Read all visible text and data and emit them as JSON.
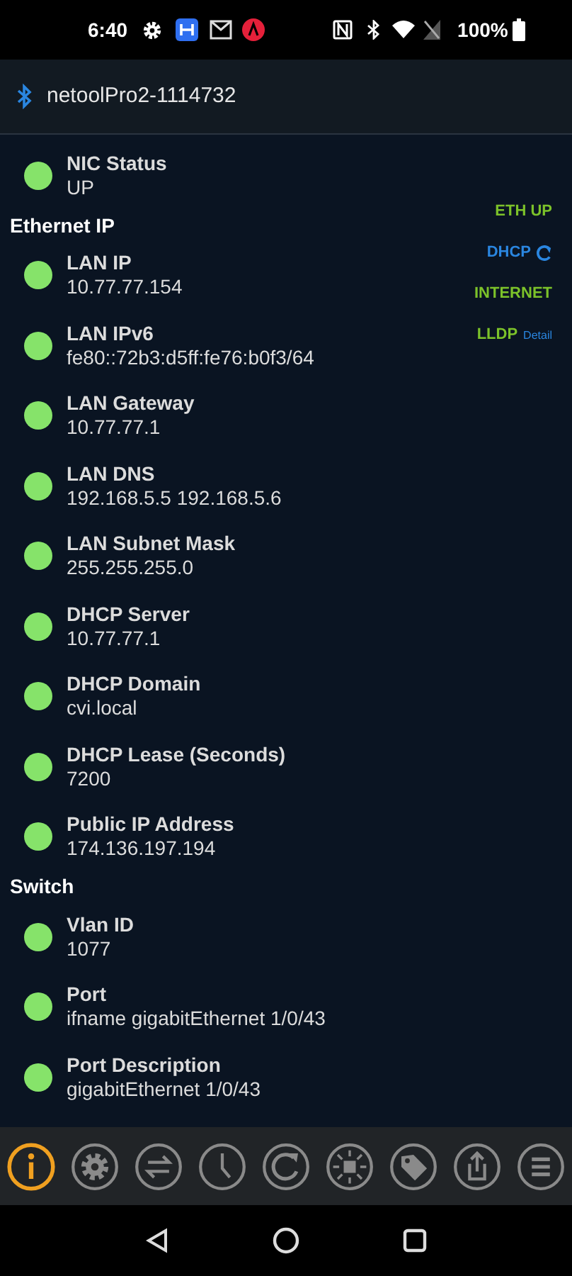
{
  "status_bar": {
    "time": "6:40",
    "battery": "100%"
  },
  "header": {
    "title": "netoolPro2-1114732"
  },
  "sections": [
    {
      "items": [
        {
          "label": "NIC Status",
          "value": "UP"
        }
      ]
    },
    {
      "title": "Ethernet IP",
      "items": [
        {
          "label": "LAN IP",
          "value": "10.77.77.154"
        },
        {
          "label": "LAN IPv6",
          "value": "fe80::72b3:d5ff:fe76:b0f3/64"
        },
        {
          "label": "LAN Gateway",
          "value": "10.77.77.1"
        },
        {
          "label": "LAN DNS",
          "value": "192.168.5.5 192.168.5.6"
        },
        {
          "label": "LAN Subnet Mask",
          "value": "255.255.255.0"
        },
        {
          "label": "DHCP Server",
          "value": "10.77.77.1"
        },
        {
          "label": "DHCP Domain",
          "value": "cvi.local"
        },
        {
          "label": "DHCP Lease (Seconds)",
          "value": "7200"
        },
        {
          "label": "Public IP Address",
          "value": "174.136.197.194"
        }
      ]
    },
    {
      "title": "Switch",
      "items": [
        {
          "label": "Vlan ID",
          "value": "1077"
        },
        {
          "label": "Port",
          "value": "ifname gigabitEthernet 1/0/43"
        },
        {
          "label": "Port Description",
          "value": "gigabitEthernet 1/0/43"
        }
      ]
    }
  ],
  "indicators": [
    {
      "label": "ETH UP",
      "color": "#7cc22a"
    },
    {
      "label": "DHCP",
      "color": "#2a86e0",
      "refresh": true
    },
    {
      "label": "INTERNET",
      "color": "#7cc22a"
    },
    {
      "label": "LLDP",
      "color": "#7cc22a",
      "link": "Detail"
    }
  ],
  "toolbar": [
    {
      "kind": "info",
      "selected": true
    },
    {
      "kind": "gear",
      "selected": false
    },
    {
      "kind": "swap",
      "selected": false
    },
    {
      "kind": "clock",
      "selected": false
    },
    {
      "kind": "refresh",
      "selected": false
    },
    {
      "kind": "sun",
      "selected": false
    },
    {
      "kind": "tag",
      "selected": false
    },
    {
      "kind": "share",
      "selected": false
    },
    {
      "kind": "list",
      "selected": false
    }
  ]
}
